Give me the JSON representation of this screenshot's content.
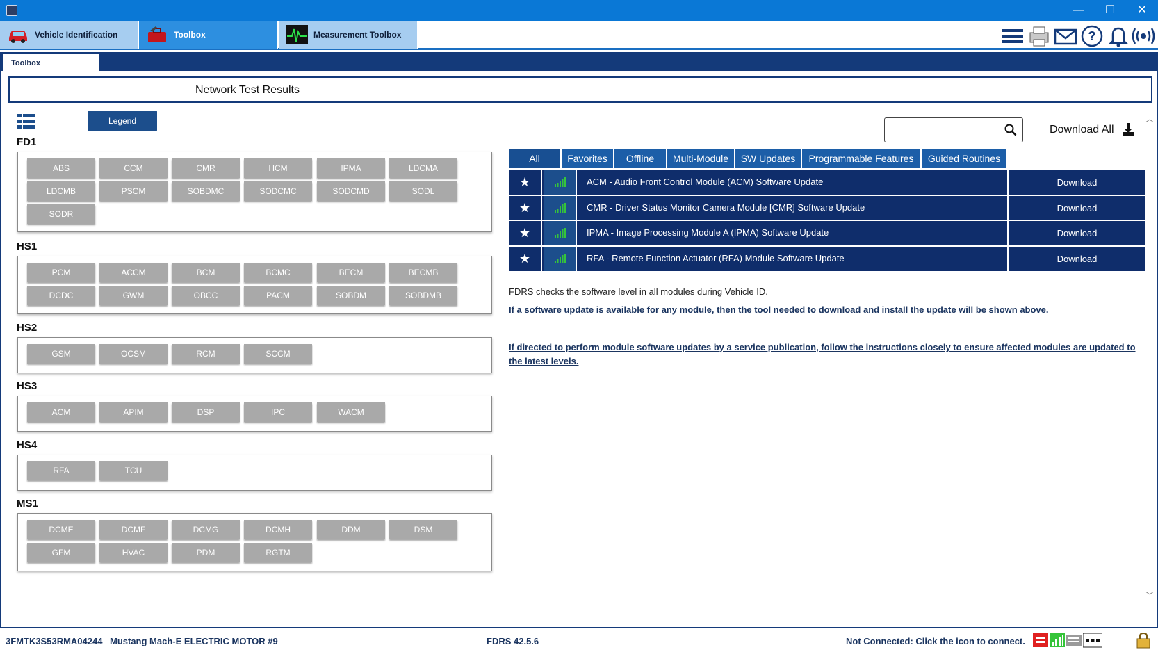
{
  "window": {
    "minimize": "—",
    "maximize": "☐",
    "close": "✕"
  },
  "app_tabs": [
    {
      "label": "Vehicle Identification",
      "icon": "car-icon"
    },
    {
      "label": "Toolbox",
      "icon": "toolbox-icon"
    },
    {
      "label": "Measurement Toolbox",
      "icon": "oscilloscope-icon"
    }
  ],
  "toolbar_icons": [
    "menu-icon",
    "printer-icon",
    "mail-icon",
    "help-icon",
    "bell-icon",
    "broadcast-icon"
  ],
  "sub_tab": "Toolbox",
  "page_title": "Network Test Results",
  "legend_label": "Legend",
  "groups": [
    {
      "name": "FD1",
      "modules": [
        "ABS",
        "CCM",
        "CMR",
        "HCM",
        "IPMA",
        "LDCMA",
        "LDCMB",
        "PSCM",
        "SOBDMC",
        "SODCMC",
        "SODCMD",
        "SODL",
        "SODR"
      ]
    },
    {
      "name": "HS1",
      "modules": [
        "PCM",
        "ACCM",
        "BCM",
        "BCMC",
        "BECM",
        "BECMB",
        "DCDC",
        "GWM",
        "OBCC",
        "PACM",
        "SOBDM",
        "SOBDMB"
      ]
    },
    {
      "name": "HS2",
      "modules": [
        "GSM",
        "OCSM",
        "RCM",
        "SCCM"
      ]
    },
    {
      "name": "HS3",
      "modules": [
        "ACM",
        "APIM",
        "DSP",
        "IPC",
        "WACM"
      ]
    },
    {
      "name": "HS4",
      "modules": [
        "RFA",
        "TCU"
      ]
    },
    {
      "name": "MS1",
      "modules": [
        "DCME",
        "DCMF",
        "DCMG",
        "DCMH",
        "DDM",
        "DSM",
        "GFM",
        "HVAC",
        "PDM",
        "RGTM"
      ]
    }
  ],
  "search": {
    "placeholder": "",
    "value": ""
  },
  "download_all_label": "Download All",
  "filter_tabs": [
    "All",
    "Favorites",
    "Offline",
    "Multi-Module",
    "SW Updates",
    "Programmable Features",
    "Guided Routines"
  ],
  "updates": [
    {
      "title": "ACM - Audio Front Control Module (ACM) Software Update",
      "action": "Download"
    },
    {
      "title": "CMR - Driver Status Monitor Camera Module [CMR] Software Update",
      "action": "Download"
    },
    {
      "title": "IPMA - Image Processing Module A (IPMA) Software Update",
      "action": "Download"
    },
    {
      "title": "RFA - Remote Function Actuator (RFA) Module Software Update",
      "action": "Download"
    }
  ],
  "info": {
    "line1": "FDRS checks the software level in all modules during Vehicle ID.",
    "line2": "If a software update is available for any module, then the tool needed to download and install the update will be shown above.",
    "link": "If directed to perform module software updates by a service publication, follow the instructions closely to ensure affected modules are updated to the latest levels."
  },
  "status": {
    "vin": "3FMTK3S53RMA04244",
    "vehicle": "Mustang Mach-E ELECTRIC MOTOR #9",
    "version": "FDRS 42.5.6",
    "connection": "Not Connected: Click the icon to connect."
  },
  "colors": {
    "titlebar": "#0a78d6",
    "navy": "#143a7a",
    "row": "#0f2d6b",
    "module_gray": "#a9a9a9",
    "signal_green": "#35c43a"
  }
}
